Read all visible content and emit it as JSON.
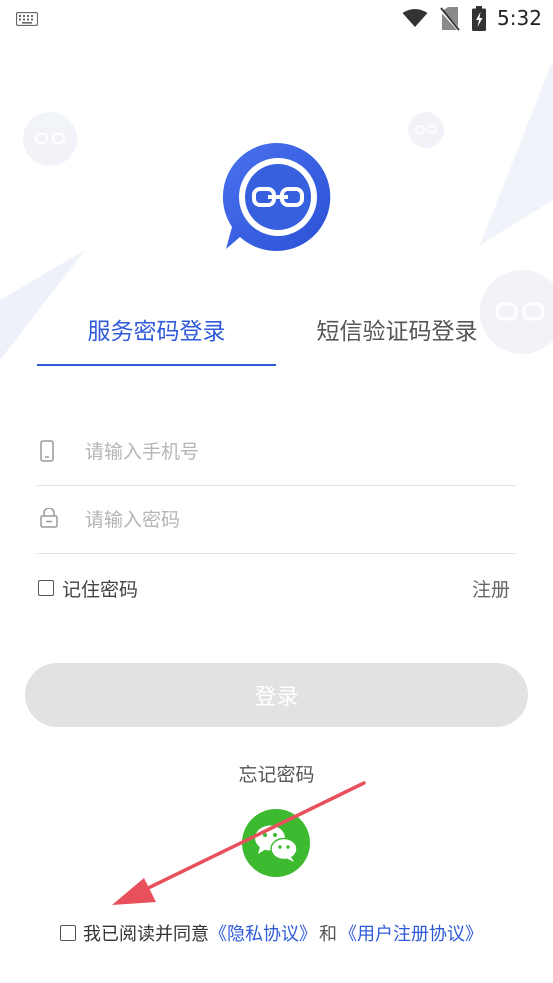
{
  "status_bar": {
    "time": "5:32",
    "icons": [
      "keyboard-icon",
      "wifi-icon",
      "no-sim-icon",
      "battery-charging-icon"
    ]
  },
  "login": {
    "tabs": [
      {
        "label": "服务密码登录",
        "active": true
      },
      {
        "label": "短信验证码登录",
        "active": false
      }
    ],
    "phone_placeholder": "请输入手机号",
    "password_placeholder": "请输入密码",
    "remember_label": "记住密码",
    "register_label": "注册",
    "login_button": "登录",
    "forgot_password": "忘记密码"
  },
  "agreement": {
    "prefix": "我已阅读并同意",
    "privacy_link": "《隐私协议》",
    "and": "和",
    "user_link": "《用户注册协议》"
  },
  "colors": {
    "accent": "#2f5bdb",
    "wechat": "#3dba30",
    "button_disabled": "#e1e2e4",
    "annotation_arrow": "#e8505b"
  }
}
